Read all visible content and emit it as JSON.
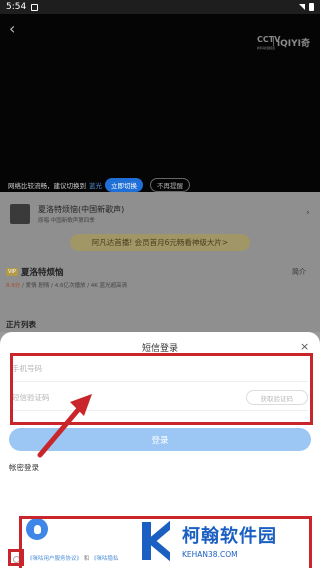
{
  "status_bar": {
    "time": "5:54"
  },
  "player": {
    "logo_cctv": "CCTV",
    "logo_cctv_sub": "新科动漫频道",
    "logo_iqiyi": "iQIYI奇",
    "network_hint": "网络比较流畅，建议切换到",
    "network_hint_highlight": "蓝光",
    "switch_button": "立即切换",
    "no_remind_button": "不再提醒"
  },
  "content": {
    "music_title": "夏洛特烦恼(中国新歌声)",
    "music_sub": "原唱·中国新歌声第四季",
    "promo": "阿凡达首播! 会员首月6元畅看神级大片>",
    "vip_tag": "VIP",
    "show_title": "夏洛特烦恼",
    "intro_link": "简介",
    "show_meta_score": "8.9分",
    "show_meta_rest": " / 爱情 剧情 / 4.6亿次播放 / 4K 蓝光超高清",
    "episodes_heading": "正片列表"
  },
  "login_sheet": {
    "title": "短信登录",
    "phone_placeholder": "手机号码",
    "code_placeholder": "短信验证码",
    "get_code_button": "获取验证码",
    "login_button": "登录",
    "password_login": "帐密登录",
    "agreement_link1": "《咪咕用户服务协议》",
    "agreement_and": "和",
    "agreement_link2": "《咪咕隐私"
  },
  "watermark": {
    "name": "柯翰软件园",
    "domain": "KEHAN38.COM"
  },
  "colors": {
    "accent_blue": "#1f6fd6",
    "login_button": "#9cc7f5",
    "annotation_red": "#c8262b",
    "watermark_blue": "#1c5fc2"
  },
  "icons": [
    "back-icon",
    "close-icon",
    "qq-icon",
    "chevron-right-icon",
    "signal-icon",
    "battery-icon"
  ]
}
